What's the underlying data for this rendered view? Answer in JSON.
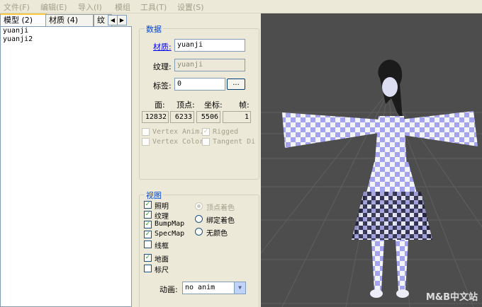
{
  "menu": [
    "文件(F)",
    "编辑(E)",
    "导入(I)",
    "模组",
    "工具(T)",
    "设置(S)"
  ],
  "tabs": [
    {
      "label": "模型 (2)",
      "active": true
    },
    {
      "label": "材质 (4)",
      "active": false
    },
    {
      "label": "纹",
      "active": false
    }
  ],
  "models": [
    "yuanji",
    "yuanji2"
  ],
  "data_group": {
    "title": "数据",
    "material_label": "材质:",
    "material_value": "yuanji",
    "texture_label": "纹理:",
    "texture_value": "yuanji",
    "tag_label": "标签:",
    "tag_value": "0",
    "browse_button": "...",
    "stats_headers": [
      "面:",
      "顶点:",
      "坐标:",
      "帧:"
    ],
    "stats_values": [
      "12832",
      "6233",
      "5506",
      "1"
    ],
    "flags": [
      {
        "label": "Vertex Anim.",
        "checked": false
      },
      {
        "label": "Rigged",
        "checked": true
      },
      {
        "label": "Vertex Color",
        "checked": false
      },
      {
        "label": "Tangent Dir",
        "checked": false
      }
    ]
  },
  "view_group": {
    "title": "视图",
    "checks": [
      {
        "label": "照明",
        "checked": true
      },
      {
        "label": "纹理",
        "checked": true
      },
      {
        "label": "BumpMap",
        "checked": true
      },
      {
        "label": "SpecMap",
        "checked": true
      },
      {
        "label": "线框",
        "checked": false
      },
      {
        "label": "地面",
        "checked": true
      },
      {
        "label": "标尺",
        "checked": false
      }
    ],
    "radios": [
      {
        "label": "顶点着色",
        "selected": true,
        "disabled": true
      },
      {
        "label": "绑定着色",
        "selected": false,
        "disabled": false
      },
      {
        "label": "无颜色",
        "selected": false,
        "disabled": false
      }
    ],
    "anim_label": "动画:",
    "anim_value": "no anim"
  },
  "watermark": "M&B中文站",
  "colors": {
    "viewport_bg": "#4d4d4d",
    "grid": "#5e5e5e",
    "check_purple": "#a3a3f0",
    "panel_bg": "#ece9d8",
    "group_title": "#0046d5"
  }
}
